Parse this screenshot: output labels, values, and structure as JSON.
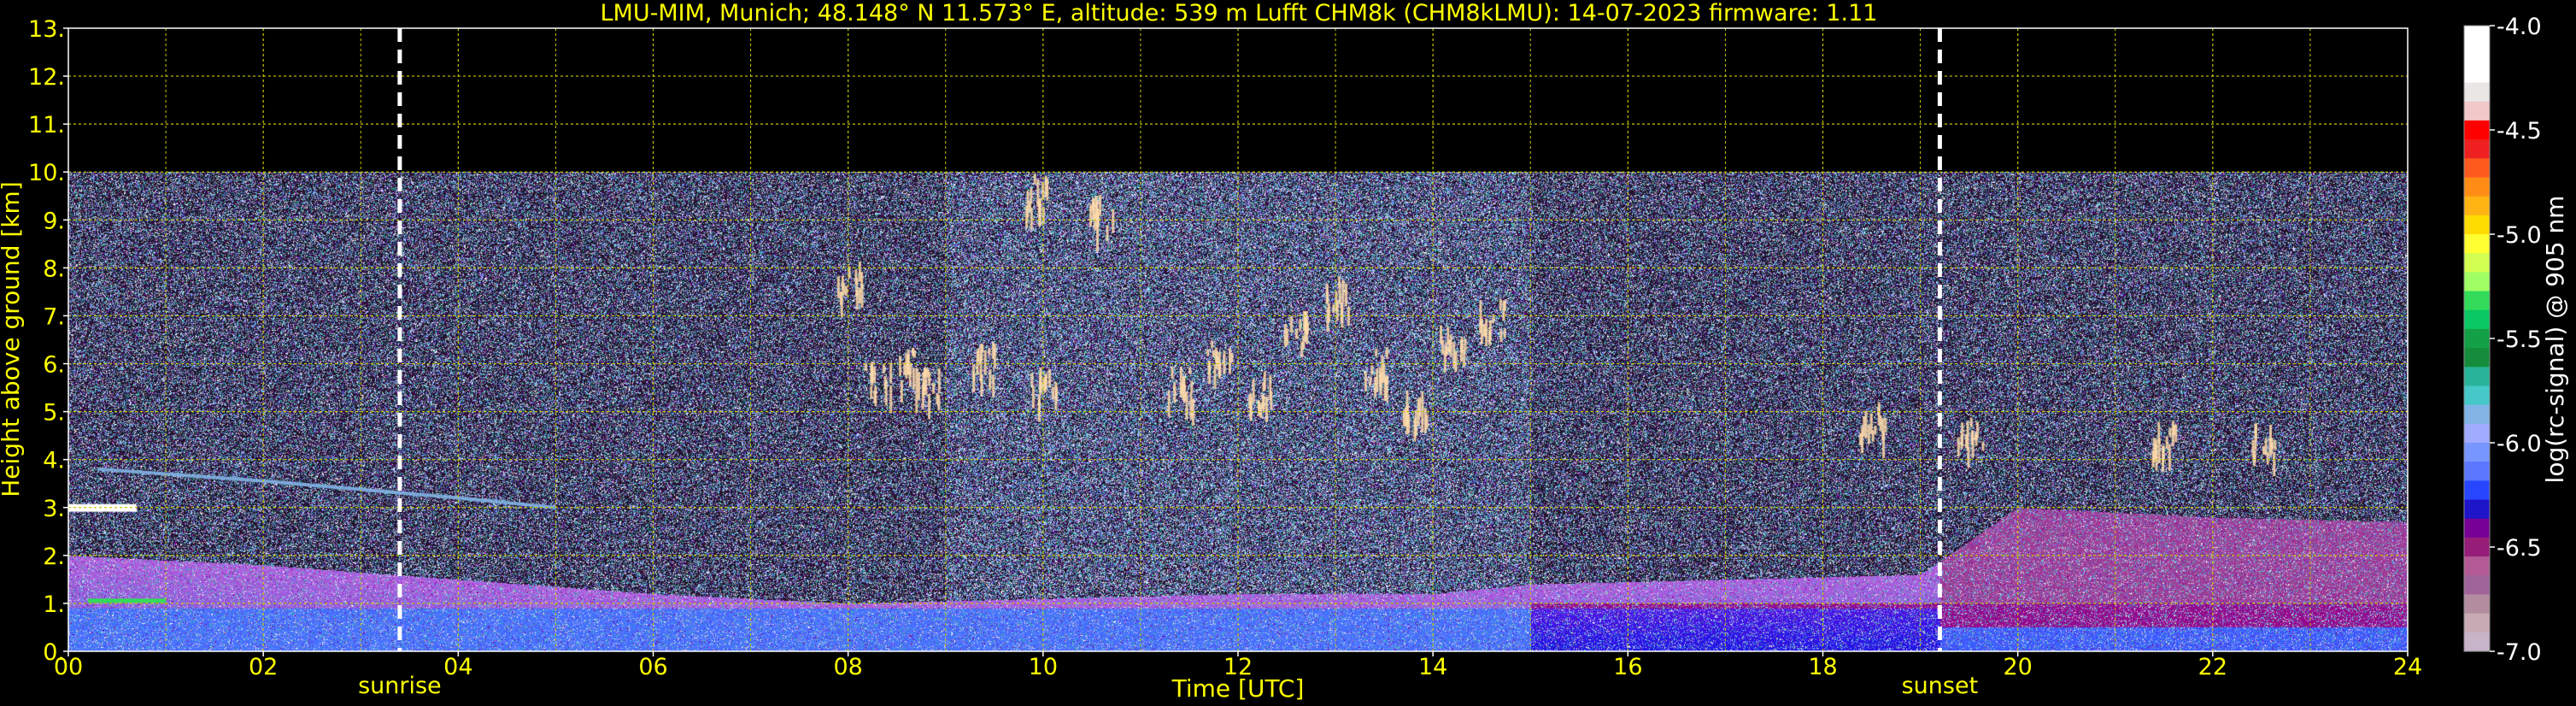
{
  "chart_data": {
    "type": "heatmap",
    "title": "LMU-MIM, Munich; 48.148° N 11.573° E, altitude: 539 m    Lufft CHM8k (CHM8kLMU): 14-07-2023    firmware: 1.11",
    "xlabel": "Time [UTC]",
    "ylabel": "Height above ground [km]",
    "xlim": [
      0,
      24
    ],
    "ylim": [
      0,
      13
    ],
    "x_ticks": [
      0,
      2,
      4,
      6,
      8,
      10,
      12,
      14,
      16,
      18,
      20,
      22,
      24
    ],
    "x_tick_labels": [
      "00",
      "02",
      "04",
      "06",
      "08",
      "10",
      "12",
      "14",
      "16",
      "18",
      "20",
      "22",
      "24"
    ],
    "y_ticks": [
      0,
      1,
      2,
      3,
      4,
      5,
      6,
      7,
      8,
      9,
      10,
      11,
      12,
      13
    ],
    "y_tick_labels": [
      "0.",
      "1.",
      "2.",
      "3.",
      "4.",
      "5.",
      "6.",
      "7.",
      "8.",
      "9.",
      "10.",
      "11.",
      "12.",
      "13."
    ],
    "grid": true,
    "signal_top_km": 10,
    "events": [
      {
        "label": "sunrise",
        "time": 3.4
      },
      {
        "label": "sunset",
        "time": 19.2
      }
    ],
    "colorbar": {
      "label": "log(rc-signal) @ 905 nm",
      "range": [
        -7.0,
        -4.0
      ],
      "ticks": [
        -4.0,
        -4.5,
        -5.0,
        -5.5,
        -6.0,
        -6.5,
        -7.0
      ],
      "tick_labels": [
        "-4.0",
        "-4.5",
        "-5.0",
        "-5.5",
        "-6.0",
        "-6.5",
        "-7.0"
      ],
      "colors_top_to_bottom": [
        "#ffffff",
        "#ffffff",
        "#ffffff",
        "#ebe6e6",
        "#f2c8c8",
        "#ff0000",
        "#ee2020",
        "#ff5a1e",
        "#ff8c14",
        "#ffb414",
        "#ffdc00",
        "#ffff32",
        "#d2ff50",
        "#a0ff64",
        "#32dc5a",
        "#0ac864",
        "#14a046",
        "#148c3c",
        "#28b49b",
        "#46c8c8",
        "#82b4e6",
        "#a0aaff",
        "#7896ff",
        "#5a78ff",
        "#2846ff",
        "#1e14c8",
        "#780096",
        "#961e78",
        "#b45a96",
        "#a0649b",
        "#b48ca0",
        "#c8aab4",
        "#c8b4c8"
      ]
    },
    "boundary_layer": [
      {
        "t": 0,
        "top": 2.0
      },
      {
        "t": 2,
        "top": 1.8
      },
      {
        "t": 4,
        "top": 1.5
      },
      {
        "t": 6,
        "top": 1.2
      },
      {
        "t": 8,
        "top": 1.0
      },
      {
        "t": 10,
        "top": 1.1
      },
      {
        "t": 12,
        "top": 1.2
      },
      {
        "t": 14,
        "top": 1.2
      },
      {
        "t": 15,
        "top": 1.4
      },
      {
        "t": 17,
        "top": 1.5
      },
      {
        "t": 19,
        "top": 1.6
      },
      {
        "t": 20,
        "top": 3.0
      },
      {
        "t": 22,
        "top": 2.8
      },
      {
        "t": 24,
        "top": 2.7
      }
    ],
    "residual_layer": [
      {
        "t": 0.3,
        "h": 3.8
      },
      {
        "t": 2,
        "h": 3.55
      },
      {
        "t": 4,
        "h": 3.2
      },
      {
        "t": 5,
        "h": 3.0
      }
    ],
    "morning_cloud": {
      "t_start": 0,
      "t_end": 0.7,
      "h": 3.0
    },
    "cirrus": [
      {
        "t": 11.4,
        "h": 5.6
      },
      {
        "t": 11.8,
        "h": 6.2
      },
      {
        "t": 12.2,
        "h": 5.5
      },
      {
        "t": 12.6,
        "h": 6.8
      },
      {
        "t": 13.0,
        "h": 7.5
      },
      {
        "t": 13.4,
        "h": 6.0
      },
      {
        "t": 13.8,
        "h": 5.2
      },
      {
        "t": 14.2,
        "h": 6.5
      },
      {
        "t": 14.6,
        "h": 7.0
      },
      {
        "t": 9.9,
        "h": 9.6
      },
      {
        "t": 10.6,
        "h": 9.2
      },
      {
        "t": 8.0,
        "h": 7.8
      },
      {
        "t": 8.6,
        "h": 6.0
      },
      {
        "t": 9.4,
        "h": 6.1
      },
      {
        "t": 10.0,
        "h": 5.6
      },
      {
        "t": 8.3,
        "h": 5.7
      },
      {
        "t": 8.8,
        "h": 5.6
      },
      {
        "t": 18.5,
        "h": 4.9
      },
      {
        "t": 19.5,
        "h": 4.6
      },
      {
        "t": 21.5,
        "h": 4.5
      },
      {
        "t": 22.5,
        "h": 4.4
      }
    ]
  }
}
